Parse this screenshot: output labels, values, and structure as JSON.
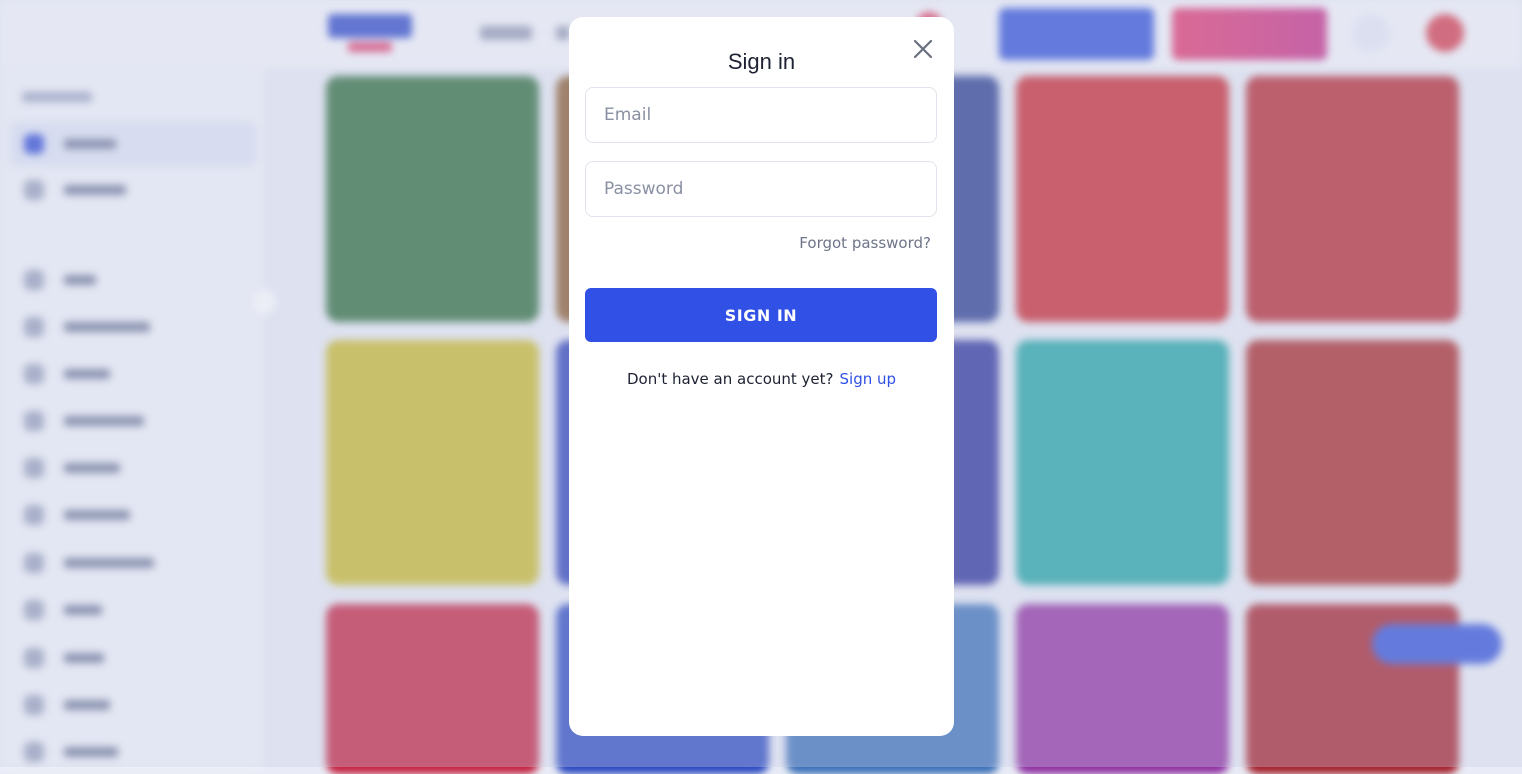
{
  "modal": {
    "title": "Sign in",
    "email_placeholder": "Email",
    "password_placeholder": "Password",
    "forgot_password": "Forgot password?",
    "submit_label": "SIGN IN",
    "no_account_text": "Don't have an account yet?",
    "signup_link": "Sign up"
  },
  "icons": {
    "close": "close-icon"
  },
  "colors": {
    "primary": "#3050e6",
    "header_signup": "#e2356b",
    "modal_bg": "#ffffff"
  },
  "background_tiles": [
    {
      "color": "#2c6b3a"
    },
    {
      "color": "#8a5a2b"
    },
    {
      "color": "#283a8f"
    },
    {
      "color": "#c9262f"
    },
    {
      "color": "#b5252f"
    },
    {
      "color": "#c9b92a"
    },
    {
      "color": "#2b3fb8"
    },
    {
      "color": "#2a2f9a"
    },
    {
      "color": "#1fa3a3"
    },
    {
      "color": "#a82626"
    },
    {
      "color": "#c4213f"
    },
    {
      "color": "#2a48c0"
    },
    {
      "color": "#3a6fb8"
    },
    {
      "color": "#8f2ea0"
    },
    {
      "color": "#a51f2a"
    }
  ]
}
